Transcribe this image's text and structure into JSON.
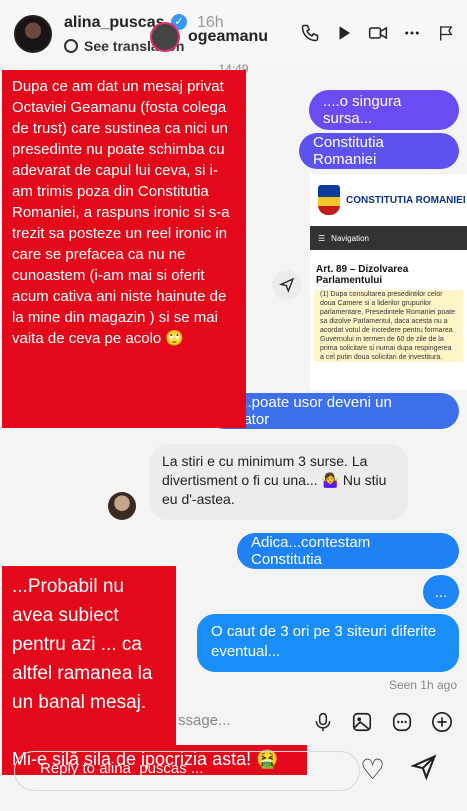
{
  "story": {
    "username": "alina_puscas",
    "time_ago": "16h",
    "translate_label": "See translation",
    "chat_title": "ogeamanu",
    "timestamp": "14:49"
  },
  "overlay_text": {
    "block1": "Dupa ce am dat un mesaj privat Octaviei Geamanu (fosta colega de trust) care sustinea ca nici un presedinte nu poate schimba cu adevarat de capul lui ceva, si i-am trimis poza din Constitutia Romaniei, a raspuns ironic si s-a trezit sa posteze un reel ironic in care se prefacea ca nu ne cunoastem (i-am mai si oferit acum cativa ani niste hainute de la mine din magazin ) si se mai vaita de ceva pe acolo 🙄",
    "block2": "...Probabil nu avea subiect pentru azi ... ca altfel ramanea la un banal mesaj.",
    "block2_tail": "Mi-e silă sila de ipocrizia asta! 🤮"
  },
  "messages": {
    "m1": "....o singura sursa...",
    "m2": "Constitutia Romaniei",
    "m3": "Da...poate usor deveni un dictator",
    "received": "La stiri e cu minimum 3 surse. La divertisment o fi cu una... 🤷‍♀️ Nu stiu eu d'-astea.",
    "m4": "Adica...contestam Constitutia",
    "m5": "...",
    "m6": "O caut de 3 ori pe 3 siteuri diferite eventual...",
    "seen": "Seen 1h ago"
  },
  "constitution_card": {
    "header": "CONSTITUTIA ROMANIEI",
    "nav": "Navigation",
    "article": "Art. 89 – Dizolvarea Parlamentului",
    "text": "(1) Dupa consultarea presedintilor celor doua Camere si a liderilor grupurilor parlamentare, Presedintele Romaniei poate sa dizolve Parlamentul, daca acesta nu a acordat votul de incredere pentru formarea Guvernului in termen de 60 de zile de la prima solicitare si numai dupa respingerea a cel putin doua solicitari de investitura."
  },
  "composer": {
    "placeholder": "ssage...",
    "reply_placeholder": "Reply to alina_puscas ..."
  },
  "colors": {
    "overlay_red": "#e3091b",
    "bubble_purple": "#5b4ee8",
    "bubble_blue": "#1a8ef8"
  }
}
